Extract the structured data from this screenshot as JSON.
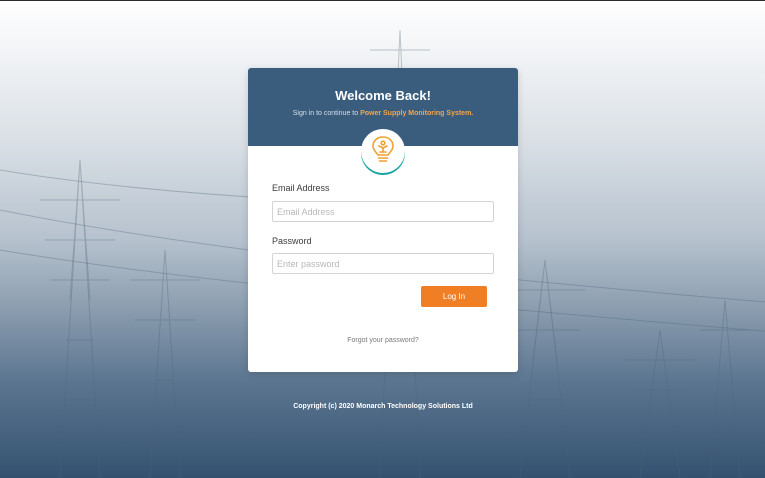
{
  "card": {
    "title": "Welcome Back!",
    "subtitle_prefix": "Sign in to continue to ",
    "subtitle_brand": "Power Supply Monitoring System.",
    "logo_icon": "lightbulb-icon"
  },
  "form": {
    "email_label": "Email Address",
    "email_placeholder": "Email Address",
    "email_value": "",
    "password_label": "Password",
    "password_placeholder": "Enter password",
    "password_value": "",
    "login_label": "Log In",
    "forgot_label": "Forgot your password?"
  },
  "footer": {
    "copyright": "Copyright (c) 2020 Monarch Technology Solutions Ltd"
  },
  "colors": {
    "header": "#3a5d7e",
    "brand_accent": "#f5a64a",
    "button": "#f07e24",
    "logo_ring": "#18a3a0"
  }
}
